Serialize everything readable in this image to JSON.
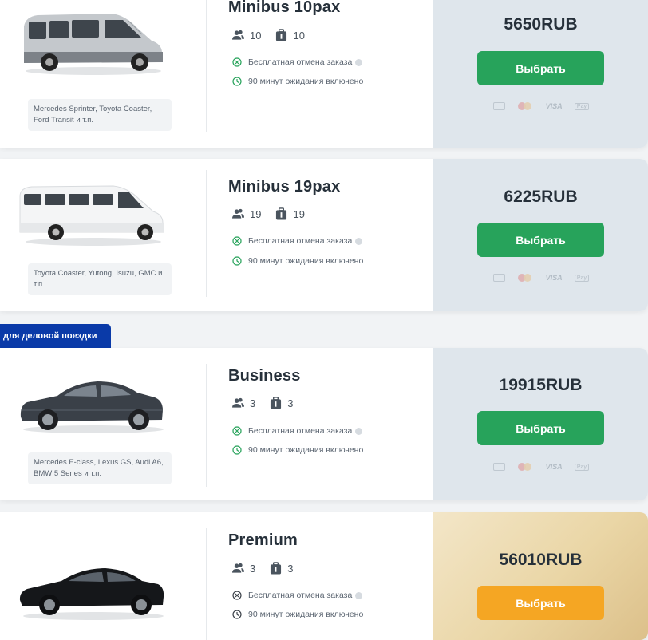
{
  "ribbon": {
    "label": "для деловой поездки"
  },
  "select_label": "Выбрать",
  "features": {
    "free_cancel": "Бесплатная отмена заказа",
    "waiting": "90 минут ожидания включено"
  },
  "payment_icons": [
    "cash-icon",
    "mastercard-icon",
    "visa-icon",
    "apple-pay-icon"
  ],
  "payment_labels": {
    "visa": "VISA",
    "apay": "Pay"
  },
  "colors": {
    "select_green": "#27a35b",
    "select_orange": "#f5a623",
    "ribbon_blue": "#0a3aa8",
    "price_panel": "#dfe6ec"
  },
  "vehicles": [
    {
      "name": "Minibus 10pax",
      "passengers": "10",
      "luggage": "10",
      "models": "Mercedes Sprinter, Toyota Coaster, Ford Transit и т.п.",
      "price": "5650RUB",
      "image": "silver-minibus"
    },
    {
      "name": "Minibus 19pax",
      "passengers": "19",
      "luggage": "19",
      "models": "Toyota Coaster, Yutong, Isuzu, GMC и т.п.",
      "price": "6225RUB",
      "image": "white-minibus"
    },
    {
      "name": "Business",
      "passengers": "3",
      "luggage": "3",
      "models": "Mercedes E-class, Lexus GS, Audi A6, BMW 5 Series и т.п.",
      "price": "19915RUB",
      "image": "dark-sedan"
    },
    {
      "name": "Premium",
      "passengers": "3",
      "luggage": "3",
      "models": "",
      "price": "56010RUB",
      "image": "black-coupe-sedan"
    }
  ]
}
